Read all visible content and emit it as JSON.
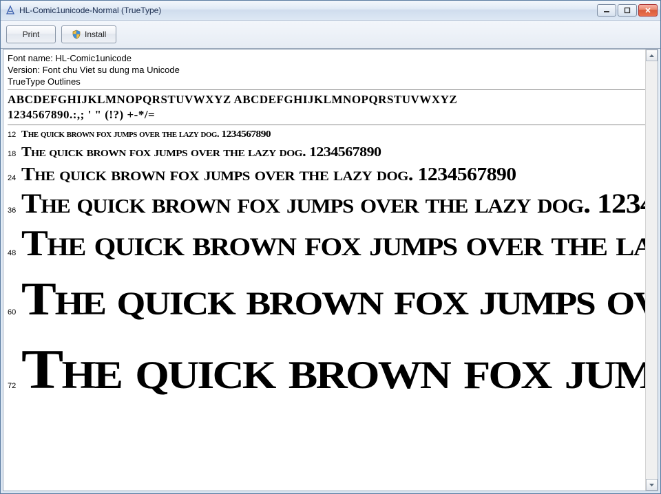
{
  "window": {
    "title": "HL-Comic1unicode-Normal (TrueType)"
  },
  "toolbar": {
    "print_label": "Print",
    "install_label": "Install"
  },
  "meta": {
    "font_name_label": "Font name: HL-Comic1unicode",
    "version_label": "Version: Font chu Viet su dung ma Unicode",
    "outlines_label": "TrueType Outlines"
  },
  "glyphs": {
    "row1": "abcdefghijklmnopqrstuvwxyz ABCDEFGHIJKLMNOPQRSTUVWXYZ",
    "row2": "1234567890.:,; ' \" (!?) +-*/="
  },
  "pangram": "The quick brown fox jumps over the lazy dog. 1234567890",
  "sizes": [
    {
      "pt": "12"
    },
    {
      "pt": "18"
    },
    {
      "pt": "24"
    },
    {
      "pt": "36"
    },
    {
      "pt": "48"
    },
    {
      "pt": "60"
    },
    {
      "pt": "72"
    }
  ]
}
